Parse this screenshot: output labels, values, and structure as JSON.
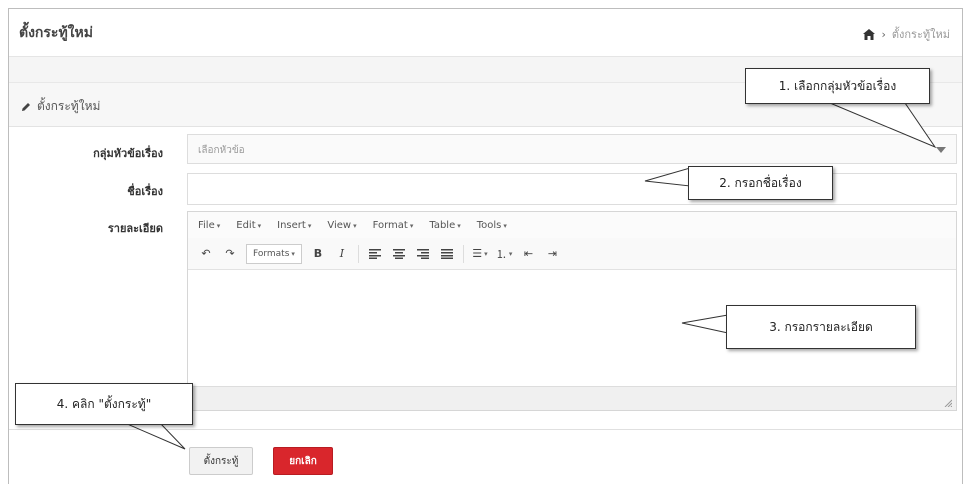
{
  "header": {
    "title": "ตั้งกระทู้ใหม่",
    "breadcrumb_current": "ตั้งกระทู้ใหม่"
  },
  "panel": {
    "heading": "ตั้งกระทู้ใหม่"
  },
  "form": {
    "group_label": "กลุ่มหัวข้อเรื่อง",
    "group_selected": "เลือกหัวข้อ",
    "title_label": "ชื่อเรื่อง",
    "title_value": "",
    "detail_label": "รายละเอียด"
  },
  "editor": {
    "menu": [
      "File",
      "Edit",
      "Insert",
      "View",
      "Format",
      "Table",
      "Tools"
    ],
    "formats_label": "Formats"
  },
  "buttons": {
    "save": "ตั้งกระทู้",
    "cancel": "ยกเลิก"
  },
  "callouts": {
    "c1": "1. เลือกกลุ่มหัวข้อเรื่อง",
    "c2": "2. กรอกชื่อเรื่อง",
    "c3": "3. กรอกรายละเอียด",
    "c4": "4. คลิก \"ตั้งกระทู้\""
  },
  "colors": {
    "cancel_button": "#d9262c",
    "panel_heading_bg": "#f7f7f7"
  },
  "icons": {
    "breadcrumb_home": "home-icon",
    "panel_heading": "pencil-icon",
    "select": "chevron-down-icon",
    "editor_resize": "resize-icon"
  }
}
